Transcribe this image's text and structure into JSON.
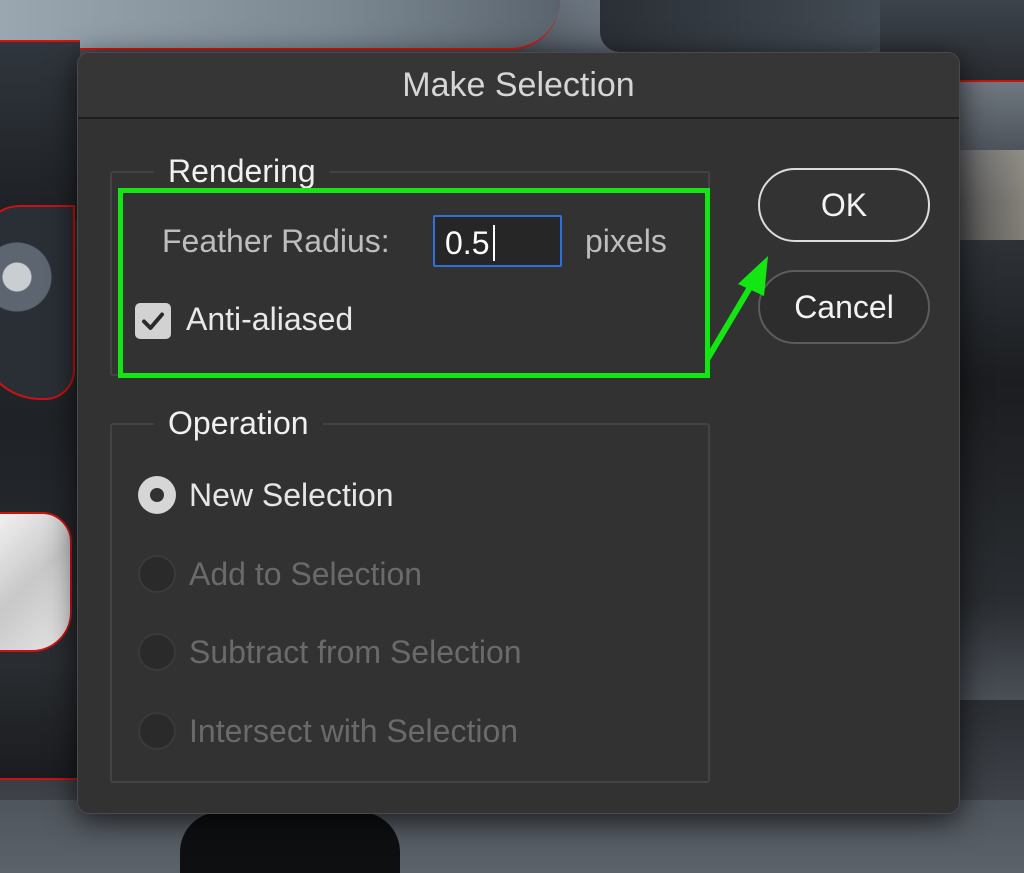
{
  "dialog": {
    "title": "Make Selection"
  },
  "rendering": {
    "legend": "Rendering",
    "feather_label": "Feather Radius:",
    "feather_value": "0.5",
    "feather_unit": "pixels",
    "anti_aliased_label": "Anti-aliased",
    "anti_aliased_checked": true
  },
  "operation": {
    "legend": "Operation",
    "options": [
      {
        "label": "New Selection",
        "selected": true,
        "enabled": true
      },
      {
        "label": "Add to Selection",
        "selected": false,
        "enabled": false
      },
      {
        "label": "Subtract from Selection",
        "selected": false,
        "enabled": false
      },
      {
        "label": "Intersect with Selection",
        "selected": false,
        "enabled": false
      }
    ]
  },
  "buttons": {
    "ok": "OK",
    "cancel": "Cancel"
  },
  "annotation": {
    "highlight_color": "#14e614",
    "arrow_icon": "arrow-up-right-icon"
  },
  "colors": {
    "dialog_bg": "#323232",
    "input_focus_border": "#2f6fd6"
  }
}
